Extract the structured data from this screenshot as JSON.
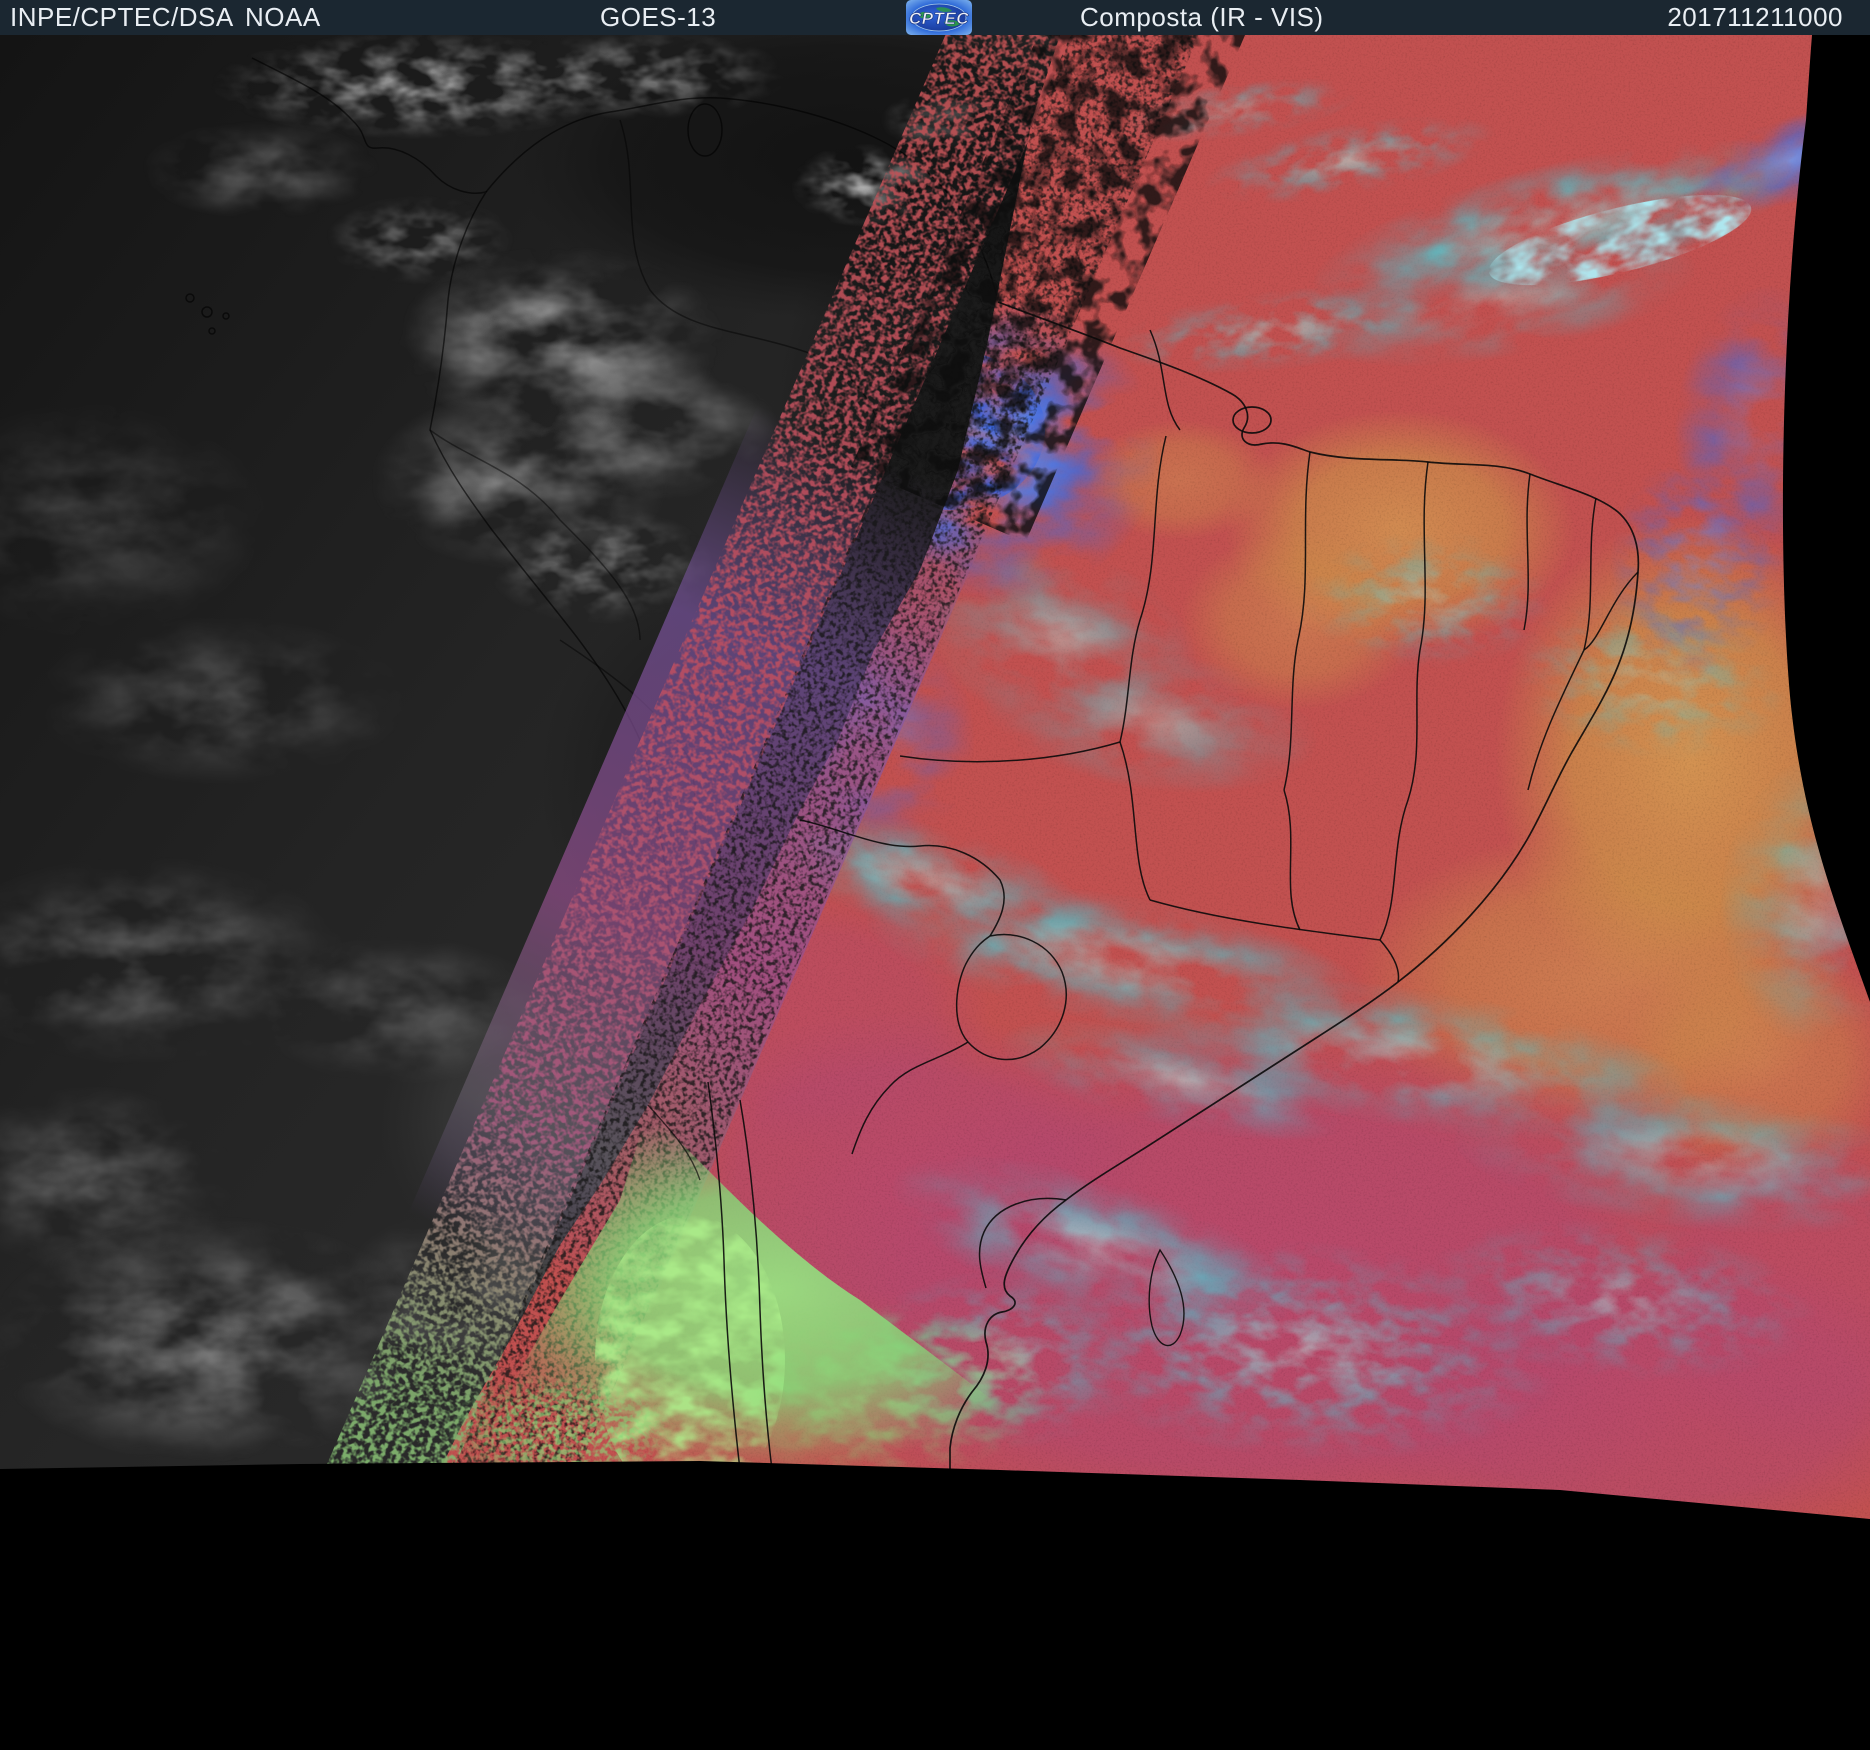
{
  "header": {
    "agency": "INPE/CPTEC/DSA",
    "noaa": "NOAA",
    "satellite": "GOES-13",
    "logo_text": "CPTEC",
    "product": "Composta (IR - VIS)",
    "timestamp": "201711211000",
    "colors": {
      "bar": "#1b2731",
      "text": "#e9eef3"
    }
  },
  "scene": {
    "description": "GOES-13 composite infrared-visible satellite image over South America; grayscale visible channel on the west (night side), rainbow IR enhancement on the east, black space beyond scan edges",
    "palette": {
      "space_black": "#000000",
      "visible_gray_base": "#262626",
      "visible_cloud": "#9a9a9a",
      "ir_warm_salmon": "#c25150",
      "ir_orange": "#cd8f4a",
      "ir_crimson": "#b4486e",
      "ir_cold_cyan": "#49cfd8",
      "ir_cold_blue": "#3a6ce4",
      "twilight_green": "#86d878",
      "terminator_purple": "#7a55a0",
      "border_line": "#0a0a0a"
    }
  }
}
